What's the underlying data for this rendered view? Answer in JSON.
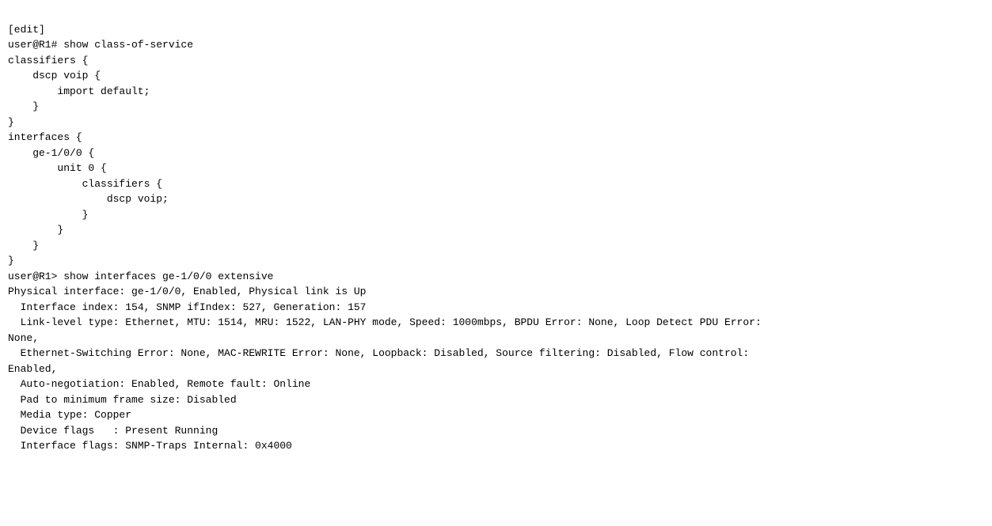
{
  "terminal": {
    "lines": [
      "[edit]",
      "user@R1# show class-of-service",
      "classifiers {",
      "    dscp voip {",
      "        import default;",
      "    }",
      "}",
      "interfaces {",
      "    ge-1/0/0 {",
      "        unit 0 {",
      "            classifiers {",
      "                dscp voip;",
      "            }",
      "        }",
      "    }",
      "}",
      "user@R1> show interfaces ge-1/0/0 extensive",
      "Physical interface: ge-1/0/0, Enabled, Physical link is Up",
      "  Interface index: 154, SNMP ifIndex: 527, Generation: 157",
      "  Link-level type: Ethernet, MTU: 1514, MRU: 1522, LAN-PHY mode, Speed: 1000mbps, BPDU Error: None, Loop Detect PDU Error:",
      "None,",
      "  Ethernet-Switching Error: None, MAC-REWRITE Error: None, Loopback: Disabled, Source filtering: Disabled, Flow control:",
      "Enabled,",
      "  Auto-negotiation: Enabled, Remote fault: Online",
      "  Pad to minimum frame size: Disabled",
      "  Media type: Copper",
      "  Device flags   : Present Running",
      "  Interface flags: SNMP-Traps Internal: 0x4000"
    ]
  }
}
